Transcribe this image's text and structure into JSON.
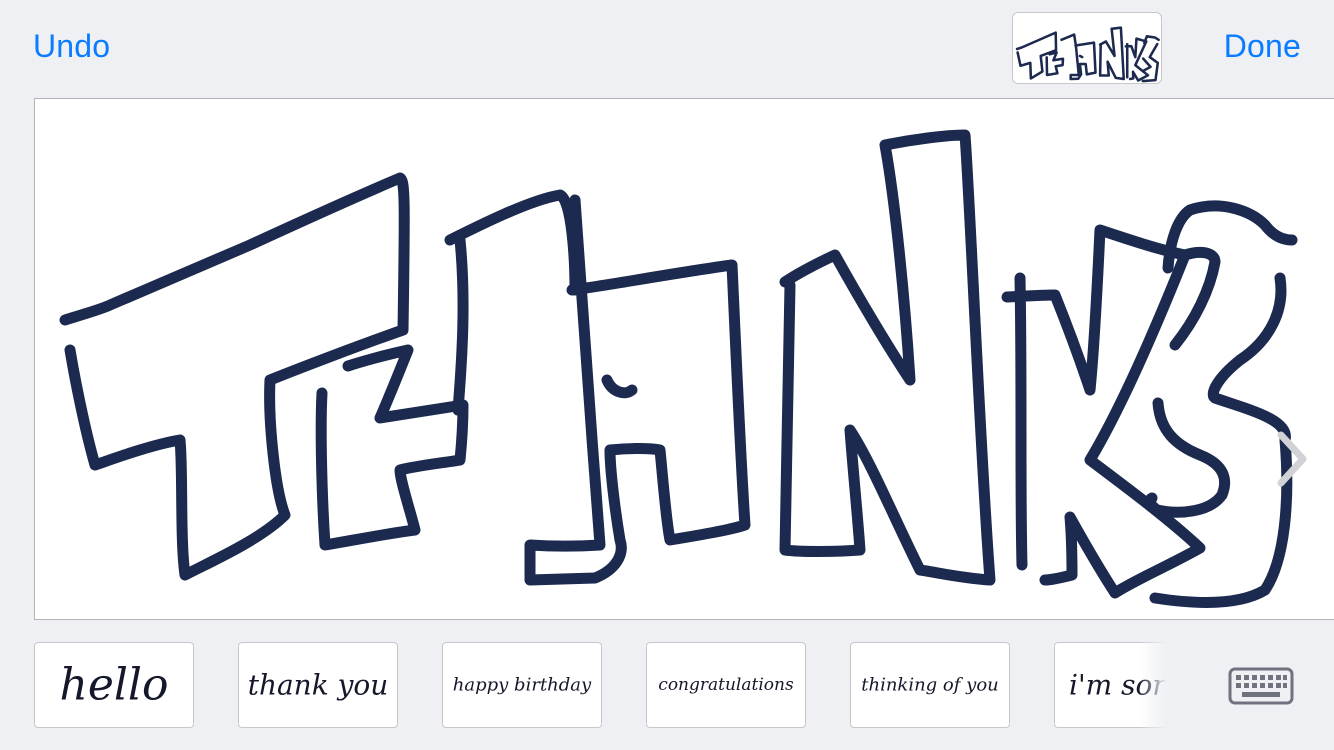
{
  "toolbar": {
    "undo_label": "Undo",
    "done_label": "Done"
  },
  "preview": {
    "icon": "thanks-drawing-thumbnail"
  },
  "canvas": {
    "icon": "thanks-handwriting",
    "ink_color": "#1d2a4f",
    "next_icon": "chevron-right-icon"
  },
  "templates": [
    {
      "label": "hello"
    },
    {
      "label": "thank you"
    },
    {
      "label": "happy birthday"
    },
    {
      "label": "congratulations"
    },
    {
      "label": "thinking of you"
    },
    {
      "label": "i'm sor"
    }
  ],
  "keyboard": {
    "icon": "keyboard-icon"
  },
  "colors": {
    "accent": "#0a7cff",
    "background": "#eff0f4",
    "ink": "#1d2a4f"
  }
}
